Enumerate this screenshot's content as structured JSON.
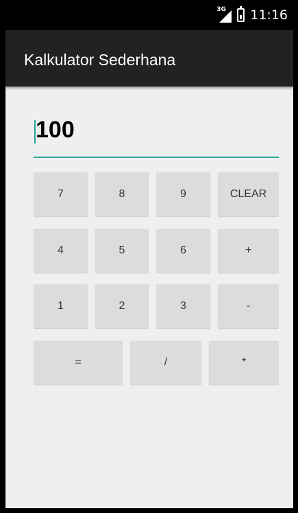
{
  "status_bar": {
    "network": "3G",
    "time": "11:16"
  },
  "app_bar": {
    "title": "Kalkulator Sederhana"
  },
  "display": {
    "value": "100"
  },
  "keypad": {
    "row1": [
      "7",
      "8",
      "9",
      "CLEAR"
    ],
    "row2": [
      "4",
      "5",
      "6",
      "+"
    ],
    "row3": [
      "1",
      "2",
      "3",
      "-"
    ],
    "row4": [
      "=",
      "/",
      "*"
    ]
  },
  "colors": {
    "accent": "#26a69a",
    "app_bar": "#222222",
    "background": "#efefef",
    "button": "#dcdcdc"
  }
}
